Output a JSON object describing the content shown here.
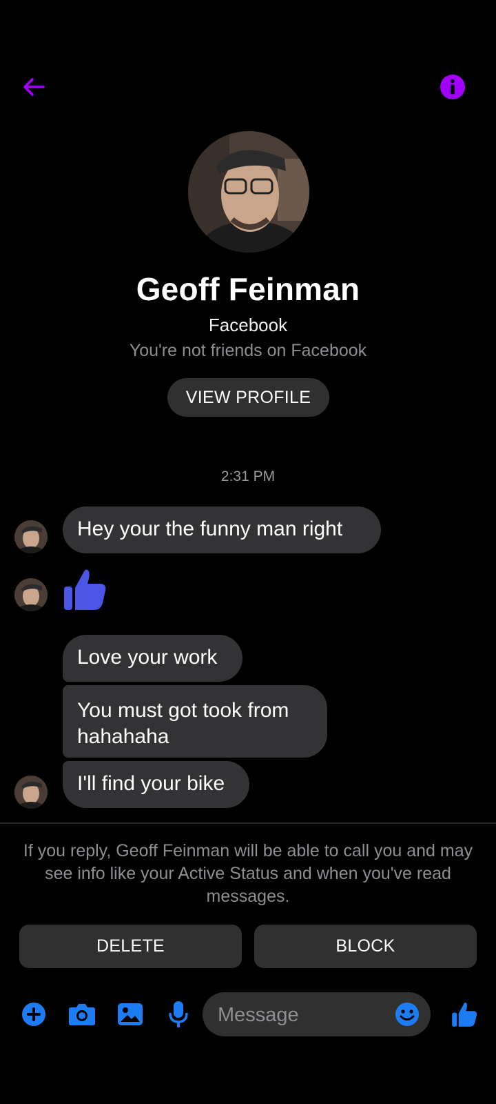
{
  "header": {
    "back_icon": "arrow-left-icon",
    "info_icon": "info-circle-icon",
    "accent_color": "#a200ff"
  },
  "profile": {
    "name": "Geoff Feinman",
    "platform": "Facebook",
    "relationship": "You're not friends on Facebook",
    "view_profile_label": "VIEW PROFILE"
  },
  "conversation": {
    "timestamp": "2:31 PM",
    "messages": [
      {
        "type": "text",
        "text": "Hey your the funny man right"
      },
      {
        "type": "like",
        "icon": "thumbs-up-icon",
        "color": "#4b55e6"
      },
      {
        "type": "text",
        "text": "Love your work"
      },
      {
        "type": "text",
        "text": "You must got took from hahahaha"
      },
      {
        "type": "text",
        "text": "I'll find your bike"
      }
    ]
  },
  "request": {
    "notice": "If you reply, Geoff Feinman will be able to call you and may see info like your Active Status and when you've read messages.",
    "delete_label": "DELETE",
    "block_label": "BLOCK"
  },
  "composer": {
    "placeholder": "Message",
    "value": "",
    "icons": [
      "plus-circle-icon",
      "camera-icon",
      "image-icon",
      "microphone-icon",
      "emoji-icon",
      "thumbs-up-icon"
    ],
    "icon_color": "#1e7cf2"
  }
}
